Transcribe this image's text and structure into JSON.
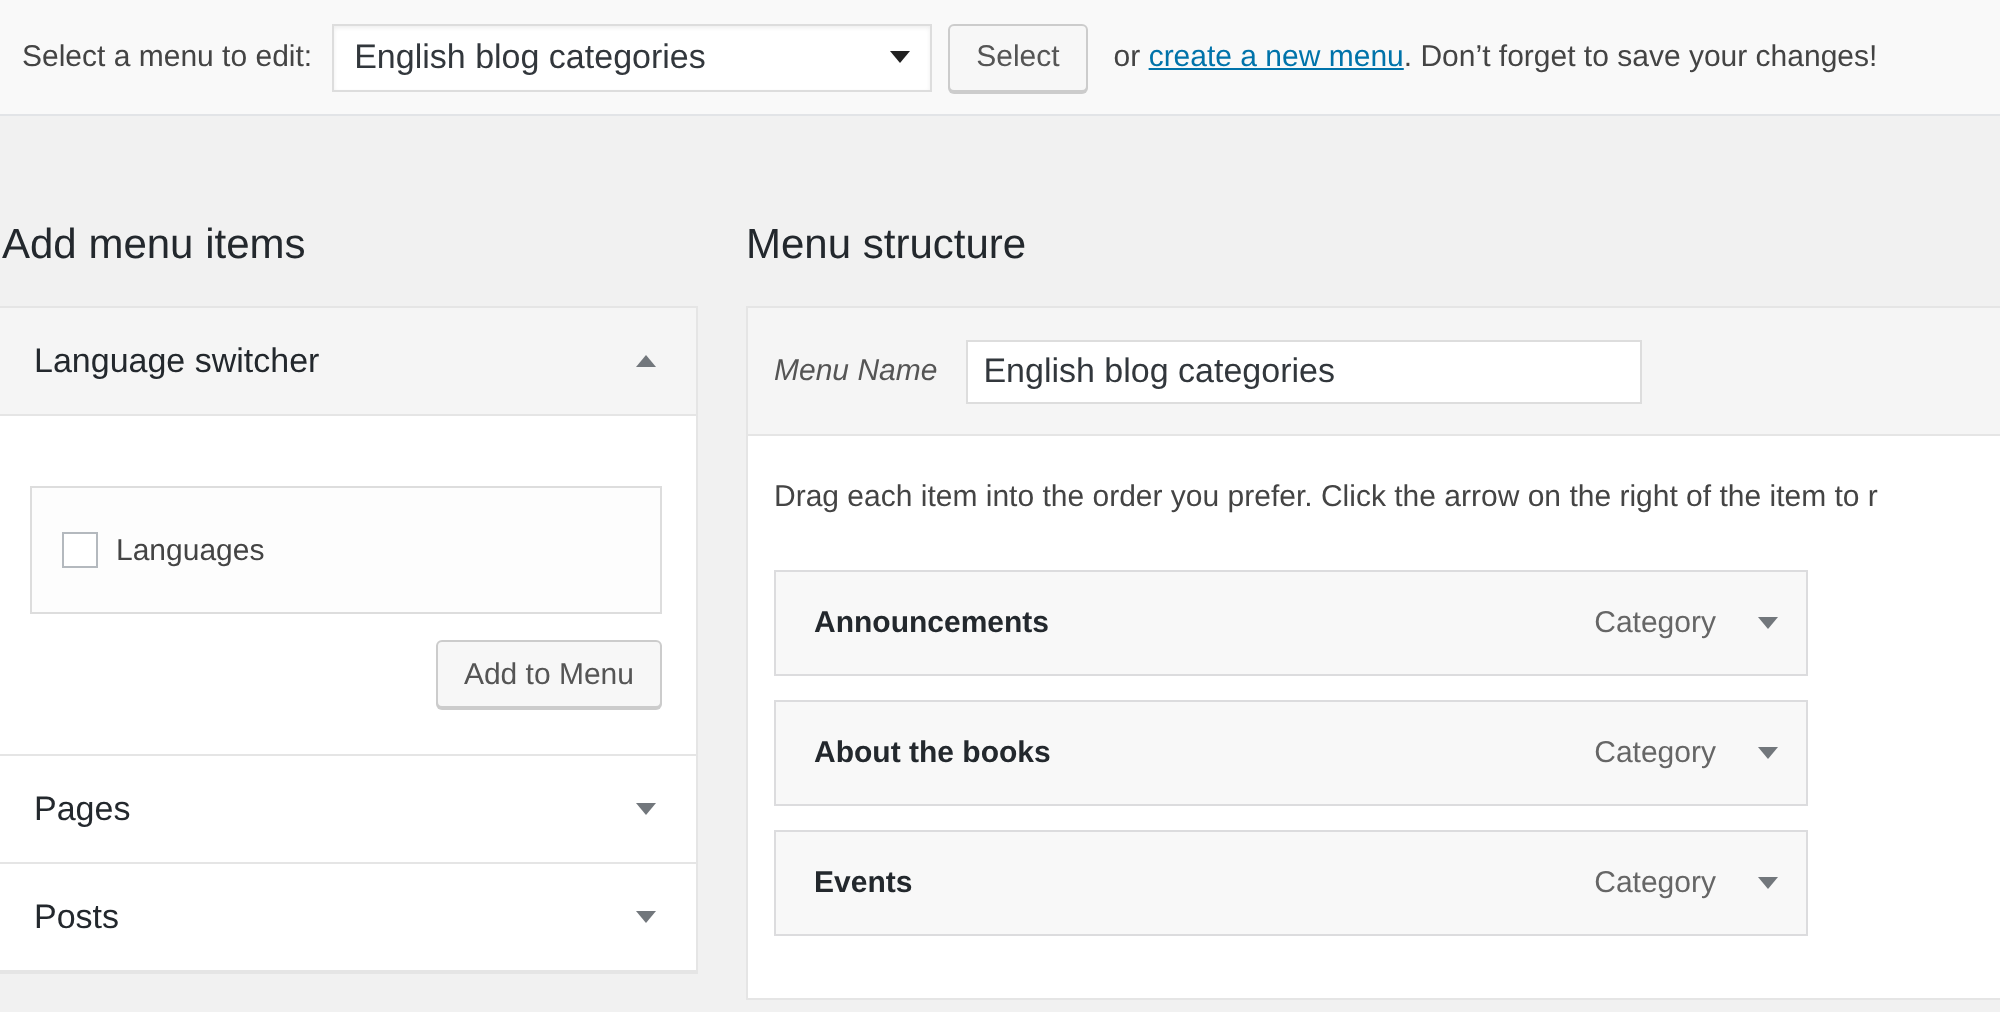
{
  "top_bar": {
    "label": "Select a menu to edit:",
    "menu_select": {
      "value": "English blog categories"
    },
    "select_button": "Select",
    "note_before": "or",
    "create_link": "create a new menu",
    "note_after": ". Don’t forget to save your changes!"
  },
  "add_items": {
    "heading": "Add menu items",
    "sections": [
      {
        "title": "Language switcher",
        "expanded": true,
        "options": [
          {
            "label": "Languages",
            "checked": false
          }
        ],
        "button": "Add to Menu"
      },
      {
        "title": "Pages",
        "expanded": false
      },
      {
        "title": "Posts",
        "expanded": false
      }
    ]
  },
  "structure": {
    "heading": "Menu structure",
    "menu_name_label": "Menu Name",
    "menu_name_value": "English blog categories",
    "instructions": "Drag each item into the order you prefer. Click the arrow on the right of the item to r",
    "items": [
      {
        "title": "Announcements",
        "type": "Category"
      },
      {
        "title": "About the books",
        "type": "Category"
      },
      {
        "title": "Events",
        "type": "Category"
      }
    ]
  }
}
